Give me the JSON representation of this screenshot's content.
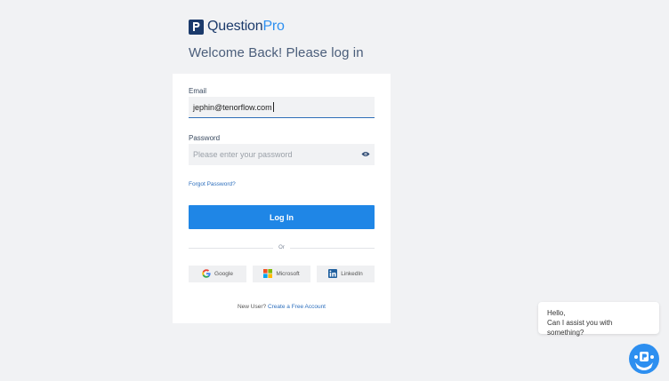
{
  "brand": {
    "name_part1": "Question",
    "name_part2": "Pro",
    "mark_letter": "P",
    "primary": "#1b3a6b",
    "accent": "#1f86e6"
  },
  "welcome": "Welcome Back! Please log in",
  "email": {
    "label": "Email",
    "value": "jephin@tenorflow.com"
  },
  "password": {
    "label": "Password",
    "placeholder": "Please enter your password",
    "toggle_icon": "eye-icon"
  },
  "forgot": "Forgot Password?",
  "login_button": "Log In",
  "divider": "Or",
  "social": {
    "google": {
      "label": "Google",
      "icon": "google-icon"
    },
    "microsoft": {
      "label": "Microsoft",
      "icon": "microsoft-icon"
    },
    "linkedin": {
      "label": "LinkedIn",
      "icon": "linkedin-icon"
    }
  },
  "new_user": {
    "text": "New User?",
    "link": "Create a Free Account"
  },
  "chat": {
    "line1": "Hello,",
    "line2": "Can I assist you with something?",
    "avatar_icon": "chatbot-avatar-icon"
  }
}
